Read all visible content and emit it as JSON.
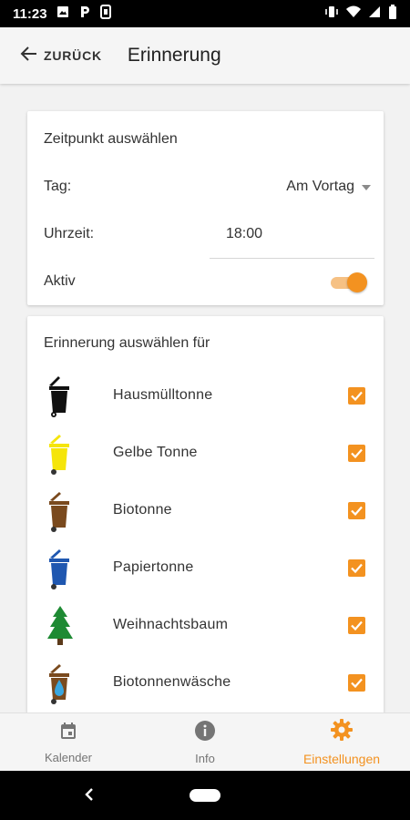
{
  "status_bar": {
    "time": "11:23",
    "icons": [
      "image-icon",
      "parking-icon",
      "sim-icon",
      "vibrate-icon",
      "wifi-icon",
      "signal-icon",
      "battery-icon"
    ]
  },
  "header": {
    "back_label": "ZURÜCK",
    "title": "Erinnerung"
  },
  "time_card": {
    "title": "Zeitpunkt auswählen",
    "day_label": "Tag:",
    "day_value": "Am Vortag",
    "time_label": "Uhrzeit:",
    "time_value": "18:00",
    "active_label": "Aktiv",
    "active_on": true
  },
  "bins_card": {
    "title": "Erinnerung auswählen für",
    "items": [
      {
        "label": "Hausmülltonne",
        "icon": "black-bin-icon",
        "color": "#111111",
        "checked": true
      },
      {
        "label": "Gelbe Tonne",
        "icon": "yellow-bin-icon",
        "color": "#f5e50a",
        "checked": true
      },
      {
        "label": "Biotonne",
        "icon": "brown-bin-icon",
        "color": "#7a4a1e",
        "checked": true
      },
      {
        "label": "Papiertonne",
        "icon": "blue-bin-icon",
        "color": "#1f57b0",
        "checked": true
      },
      {
        "label": "Weihnachtsbaum",
        "icon": "christmas-tree-icon",
        "color": "#1e8a33",
        "checked": true
      },
      {
        "label": "Biotonnenwäsche",
        "icon": "bin-wash-icon",
        "color": "#7a4a1e",
        "checked": true
      }
    ]
  },
  "bottom_nav": [
    {
      "label": "Kalender",
      "icon": "calendar-icon",
      "active": false
    },
    {
      "label": "Info",
      "icon": "info-icon",
      "active": false
    },
    {
      "label": "Einstellungen",
      "icon": "settings-gear-icon",
      "active": true
    }
  ],
  "colors": {
    "accent": "#f39220",
    "accent_light": "#f6c184"
  }
}
